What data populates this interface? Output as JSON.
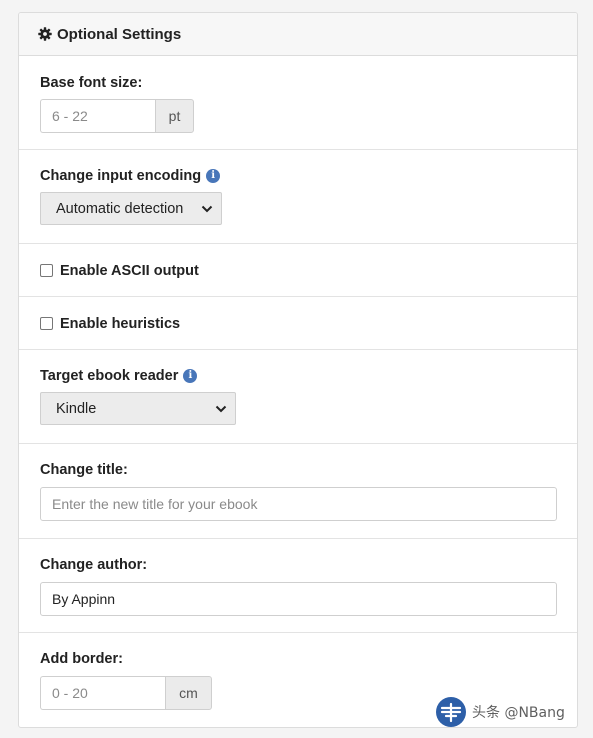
{
  "header": {
    "title": "Optional Settings",
    "icon": "gear-icon"
  },
  "base_font_size": {
    "label": "Base font size:",
    "placeholder": "6 - 22",
    "unit": "pt"
  },
  "input_encoding": {
    "label": "Change input encoding",
    "info_icon": "info-icon",
    "selected": "Automatic detection"
  },
  "ascii_output": {
    "label": "Enable ASCII output",
    "checked": false
  },
  "heuristics": {
    "label": "Enable heuristics",
    "checked": false
  },
  "ebook_reader": {
    "label": "Target ebook reader",
    "info_icon": "info-icon",
    "selected": "Kindle"
  },
  "title": {
    "label": "Change title:",
    "placeholder": "Enter the new title for your ebook"
  },
  "author": {
    "label": "Change author:",
    "value": "By Appinn"
  },
  "border": {
    "label": "Add border:",
    "placeholder": "0 - 20",
    "unit": "cm"
  },
  "watermark": {
    "text": "头条 @NBang"
  },
  "colors": {
    "info_badge": "#4876b9",
    "panel_header_bg": "#f7f7f7",
    "addon_bg": "#ebebeb",
    "select_bg": "#ececec"
  }
}
